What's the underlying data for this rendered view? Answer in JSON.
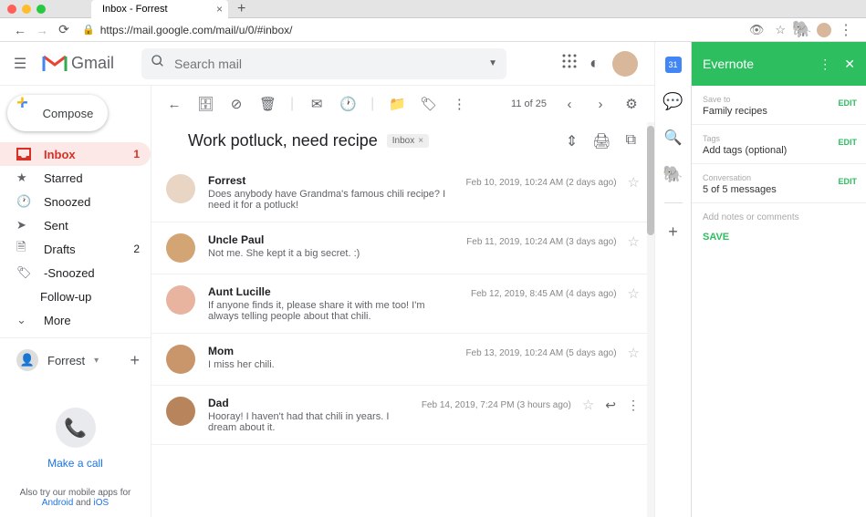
{
  "browser": {
    "tab_title": "Inbox - Forrest",
    "url": "https://mail.google.com/mail/u/0/#inbox/"
  },
  "gmail": {
    "brand": "Gmail",
    "search_placeholder": "Search mail",
    "compose": "Compose",
    "sidebar": [
      {
        "icon": "inbox",
        "label": "Inbox",
        "count": "1",
        "active": true
      },
      {
        "icon": "star",
        "label": "Starred"
      },
      {
        "icon": "clock",
        "label": "Snoozed"
      },
      {
        "icon": "send",
        "label": "Sent"
      },
      {
        "icon": "file",
        "label": "Drafts",
        "count": "2"
      },
      {
        "icon": "tag",
        "label": "-Snoozed"
      },
      {
        "icon": "",
        "label": "Follow-up",
        "indent": true
      },
      {
        "icon": "chevron",
        "label": "More"
      }
    ],
    "user": "Forrest",
    "call_link": "Make a call",
    "mobile_promo_pre": "Also try our mobile apps for ",
    "mobile_promo_and": "Android",
    "mobile_promo_mid": " and ",
    "mobile_promo_ios": "iOS"
  },
  "thread": {
    "count": "11 of 25",
    "subject": "Work potluck, need recipe",
    "label": "Inbox",
    "messages": [
      {
        "from": "Forrest",
        "snippet": "Does anybody have Grandma's famous chili recipe? I need it for a potluck!",
        "date": "Feb 10, 2019, 10:24 AM (2 days ago)",
        "avatar": "#e8d5c4"
      },
      {
        "from": "Uncle Paul",
        "snippet": "Not me. She kept it a big secret. :)",
        "date": "Feb 11, 2019, 10:24 AM (3 days ago)",
        "avatar": "#d4a574"
      },
      {
        "from": "Aunt Lucille",
        "snippet": "If anyone finds it, please share it with me too! I'm always telling people about that chili.",
        "date": "Feb 12, 2019, 8:45 AM (4 days ago)",
        "avatar": "#e8b4a0"
      },
      {
        "from": "Mom",
        "snippet": "I miss her chili.",
        "date": "Feb 13, 2019, 10:24 AM (5 days ago)",
        "avatar": "#c9956b"
      },
      {
        "from": "Dad",
        "snippet": "Hooray! I haven't had that chili in years. I dream about it.",
        "date": "Feb 14, 2019, 7:24 PM (3 hours ago)",
        "avatar": "#b8845c",
        "expanded": true
      }
    ]
  },
  "rail": {
    "cal_text": "31"
  },
  "evernote": {
    "title": "Evernote",
    "save_to_label": "Save to",
    "save_to_value": "Family recipes",
    "tags_label": "Tags",
    "tags_value": "Add tags (optional)",
    "conv_label": "Conversation",
    "conv_value": "5 of 5 messages",
    "notes_placeholder": "Add notes or comments",
    "edit": "EDIT",
    "save": "SAVE"
  }
}
